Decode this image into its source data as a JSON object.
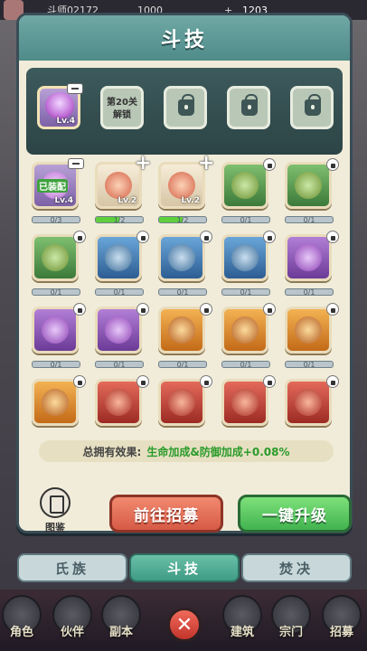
{
  "topbar": {
    "player_name": "斗师02172",
    "stat_a": "1000",
    "stat_b": "+",
    "stat_c": "1203"
  },
  "panel": {
    "title": "斗技"
  },
  "slots": [
    {
      "kind": "equipped",
      "level": "Lv.4"
    },
    {
      "kind": "unlock",
      "text_line1": "第20关",
      "text_line2": "解锁"
    },
    {
      "kind": "locked"
    },
    {
      "kind": "locked"
    },
    {
      "kind": "locked"
    }
  ],
  "skills": [
    {
      "quality": "equipped",
      "badge": "minus",
      "equipped_label": "已装配",
      "level": "Lv.4",
      "progress": "0/3",
      "fill": 0
    },
    {
      "quality": "white",
      "badge": "plus",
      "level": "Lv.2",
      "progress": "1/2",
      "fill": 0.5
    },
    {
      "quality": "white",
      "badge": "plus",
      "level": "Lv.2",
      "progress": "1/2",
      "fill": 0.5
    },
    {
      "quality": "green",
      "badge": "lock",
      "progress": "0/1",
      "fill": 0
    },
    {
      "quality": "green",
      "badge": "lock",
      "progress": "0/1",
      "fill": 0
    },
    {
      "quality": "green",
      "badge": "lock",
      "progress": "0/1",
      "fill": 0
    },
    {
      "quality": "blue",
      "badge": "lock",
      "progress": "0/1",
      "fill": 0
    },
    {
      "quality": "blue",
      "badge": "lock",
      "progress": "0/1",
      "fill": 0
    },
    {
      "quality": "blue",
      "badge": "lock",
      "progress": "0/1",
      "fill": 0
    },
    {
      "quality": "purple",
      "badge": "lock",
      "progress": "0/1",
      "fill": 0
    },
    {
      "quality": "purple",
      "badge": "lock",
      "progress": "0/1",
      "fill": 0
    },
    {
      "quality": "purple",
      "badge": "lock",
      "progress": "0/1",
      "fill": 0
    },
    {
      "quality": "orange",
      "badge": "lock",
      "progress": "0/1",
      "fill": 0
    },
    {
      "quality": "orange",
      "badge": "lock",
      "progress": "0/1",
      "fill": 0
    },
    {
      "quality": "orange",
      "badge": "lock",
      "progress": "0/1",
      "fill": 0
    },
    {
      "quality": "orange",
      "badge": "lock",
      "progress": "",
      "fill": 0
    },
    {
      "quality": "red",
      "badge": "lock",
      "progress": "",
      "fill": 0
    },
    {
      "quality": "red",
      "badge": "lock",
      "progress": "",
      "fill": 0
    },
    {
      "quality": "red",
      "badge": "lock",
      "progress": "",
      "fill": 0
    },
    {
      "quality": "red",
      "badge": "lock",
      "progress": "",
      "fill": 0
    }
  ],
  "effect": {
    "label": "总拥有效果:",
    "value": "生命加成&防御加成+0.08%"
  },
  "codex": {
    "label": "图鉴"
  },
  "buttons": {
    "recruit": "前往招募",
    "upgrade": "一键升级"
  },
  "tabs": [
    {
      "label": "氏族",
      "active": false
    },
    {
      "label": "斗技",
      "active": true
    },
    {
      "label": "焚决",
      "active": false
    }
  ],
  "nav": [
    {
      "label": "角色"
    },
    {
      "label": "伙伴"
    },
    {
      "label": "副本"
    },
    {
      "label": "建筑"
    },
    {
      "label": "宗门"
    },
    {
      "label": "招募"
    }
  ],
  "close": {
    "symbol": "✕"
  }
}
